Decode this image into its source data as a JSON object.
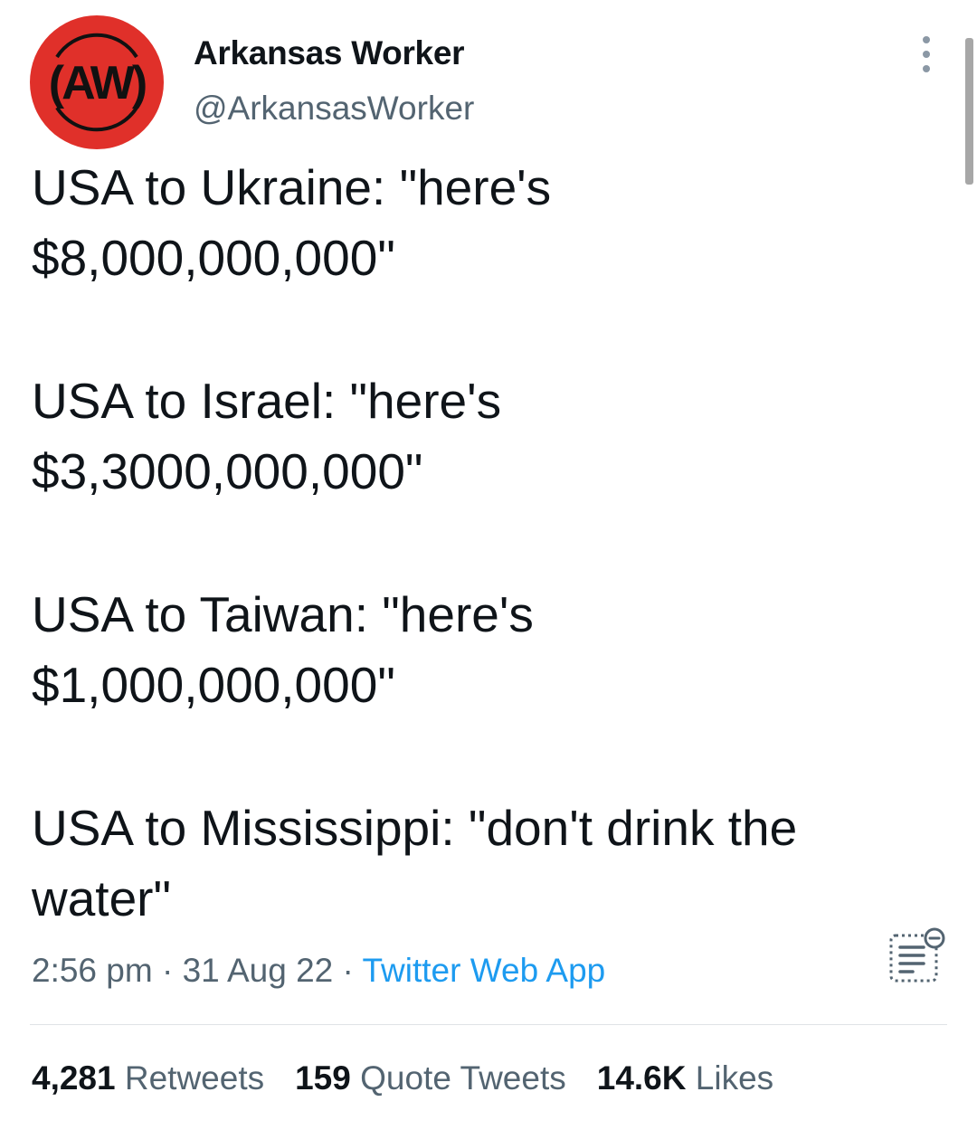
{
  "author": {
    "display_name": "Arkansas Worker",
    "handle": "@ArkansasWorker",
    "avatar_text": "AW",
    "avatar_color": "#e0302a"
  },
  "tweet": {
    "lines": [
      "USA to Ukraine: \"here's",
      "$8,000,000,000\"",
      "USA to Israel: \"here's",
      "$3,3000,000,000\"",
      "USA to Taiwan: \"here's",
      "$1,000,000,000\"",
      "USA to Mississippi: \"don't drink the",
      "water\""
    ]
  },
  "meta": {
    "time": "2:56 pm",
    "separator": "·",
    "date": "31 Aug 22",
    "source": "Twitter Web App"
  },
  "stats": {
    "retweets_count": "4,281",
    "retweets_label": "Retweets",
    "quotes_count": "159",
    "quotes_label": "Quote Tweets",
    "likes_count": "14.6K",
    "likes_label": "Likes"
  },
  "icons": {
    "more": "more-options-icon",
    "analytics": "tweet-analytics-icon"
  },
  "colors": {
    "link": "#1d9bf0",
    "secondary_text": "#536471",
    "primary_text": "#0f1419"
  }
}
